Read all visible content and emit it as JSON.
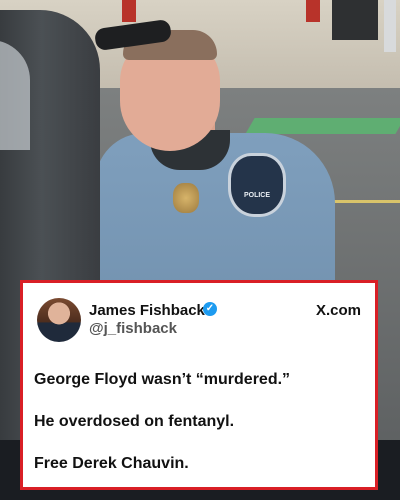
{
  "photo": {
    "patch_text": "POLICE"
  },
  "tweet": {
    "author_name": "James Fishback",
    "handle": "@j_fishback",
    "site": "X.com",
    "verified_icon": "verified-badge-icon",
    "lines": [
      "George Floyd wasn’t “murdered.”",
      "He overdosed on fentanyl.",
      "Free Derek Chauvin."
    ]
  },
  "colors": {
    "card_border": "#d91f26",
    "verified": "#1d9bf0"
  }
}
